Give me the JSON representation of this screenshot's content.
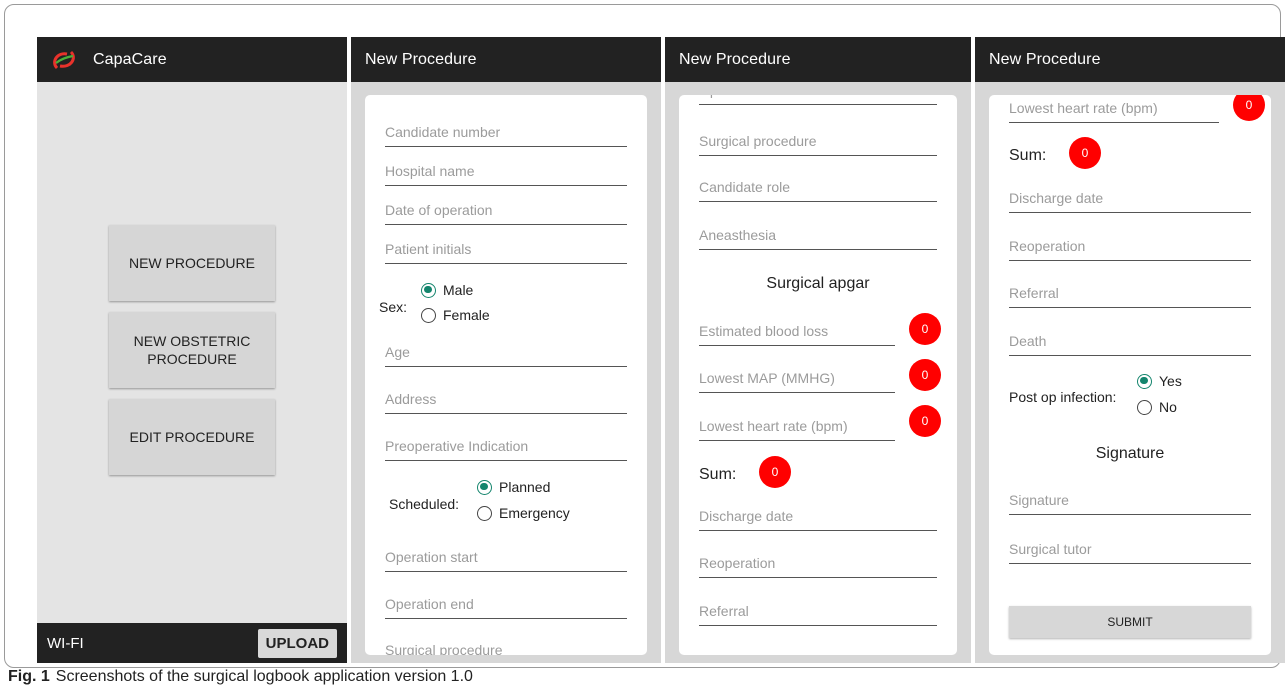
{
  "screen1": {
    "app_title": "CapaCare",
    "buttons": [
      "NEW PROCEDURE",
      "NEW OBSTETRIC PROCEDURE",
      "EDIT PROCEDURE"
    ],
    "wifi": "WI-FI",
    "upload": "UPLOAD"
  },
  "screen2": {
    "title": "New Procedure",
    "fields": [
      "Candidate number",
      "Hospital name",
      "Date of operation",
      "Patient initials",
      "Age",
      "Address",
      "Preoperative Indication",
      "Operation start",
      "Operation end",
      "Surgical procedure"
    ],
    "sex_label": "Sex:",
    "sex_options": [
      "Male",
      "Female"
    ],
    "scheduled_label": "Scheduled:",
    "scheduled_options": [
      "Planned",
      "Emergency"
    ]
  },
  "screen3": {
    "title": "New Procedure",
    "fields": [
      "Operation end",
      "Surgical procedure",
      "Candidate role",
      "Aneasthesia",
      "Discharge date",
      "Reoperation",
      "Referral"
    ],
    "apgar_title": "Surgical apgar",
    "apgar_fields": [
      "Estimated blood loss",
      "Lowest MAP (MMHG)",
      "Lowest heart rate (bpm)"
    ],
    "apgar_values": [
      "0",
      "0",
      "0"
    ],
    "sum_label": "Sum:",
    "sum_value": "0"
  },
  "screen4": {
    "title": "New Procedure",
    "lowest_hr": "Lowest heart rate (bpm)",
    "lowest_hr_value": "0",
    "sum_label": "Sum:",
    "sum_value": "0",
    "fields": [
      "Discharge date",
      "Reoperation",
      "Referral",
      "Death"
    ],
    "infection_label": "Post op infection:",
    "infection_options": [
      "Yes",
      "No"
    ],
    "signature_title": "Signature",
    "signature_fields": [
      "Signature",
      "Surgical tutor"
    ],
    "submit": "SUBMIT"
  },
  "caption": {
    "label": "Fig. 1",
    "text": "Screenshots of the surgical logbook application version 1.0"
  },
  "colors": {
    "appbar": "#222222",
    "badge": "#ff0000",
    "radio_on": "#14856d"
  }
}
